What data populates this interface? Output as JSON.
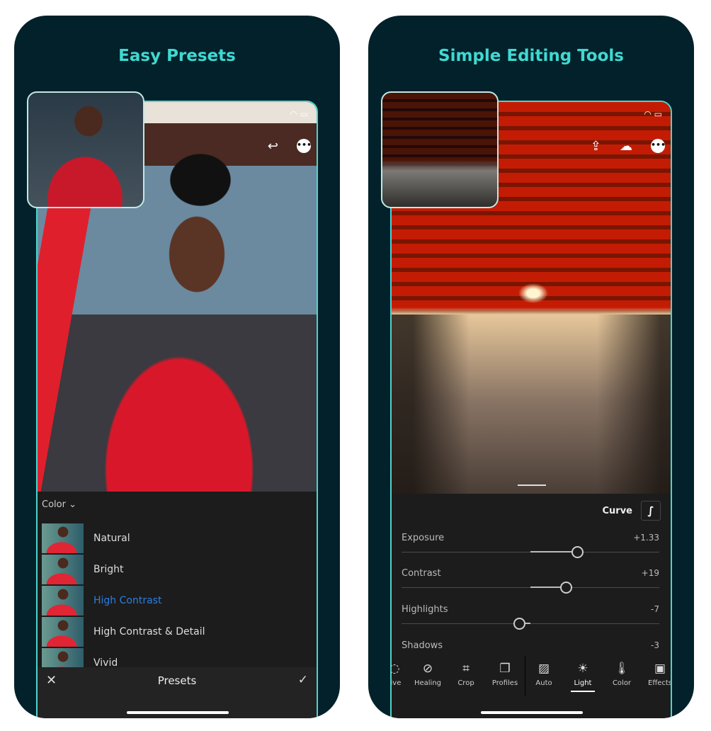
{
  "left_card": {
    "title": "Easy Presets",
    "status_icons": [
      "wifi-icon",
      "battery-icon"
    ],
    "top_icons": [
      "undo-icon",
      "more-icon"
    ],
    "category_label": "Color",
    "presets": [
      {
        "label": "Natural"
      },
      {
        "label": "Bright"
      },
      {
        "label": "High Contrast",
        "selected": true
      },
      {
        "label": "High Contrast & Detail"
      },
      {
        "label": "Vivid"
      }
    ],
    "bottom_bar": {
      "title": "Presets",
      "cancel_icon": "close-icon",
      "confirm_icon": "check-icon"
    },
    "selected_color": "#2a7ee0"
  },
  "right_card": {
    "title": "Simple Editing Tools",
    "top_icons": [
      "share-icon",
      "cloud-synced-icon",
      "more-icon"
    ],
    "curve_label": "Curve",
    "sliders": [
      {
        "name": "Exposure",
        "value": "+1.33",
        "level": 0.33
      },
      {
        "name": "Contrast",
        "value": "+19",
        "level": 0.25
      },
      {
        "name": "Highlights",
        "value": "-7",
        "level": -0.08
      },
      {
        "name": "Shadows",
        "value": "-3",
        "level": -0.03
      }
    ],
    "tools": [
      {
        "label": "tive",
        "icon": "selective-icon"
      },
      {
        "label": "Healing",
        "icon": "bandage-icon"
      },
      {
        "label": "Crop",
        "icon": "crop-icon"
      },
      {
        "label": "Profiles",
        "icon": "profiles-icon"
      },
      {
        "label": "Auto",
        "icon": "auto-icon"
      },
      {
        "label": "Light",
        "icon": "sun-icon",
        "active": true
      },
      {
        "label": "Color",
        "icon": "thermometer-icon"
      },
      {
        "label": "Effects",
        "icon": "effects-icon"
      }
    ]
  },
  "colors": {
    "card_bg": "#03212a",
    "title": "#3fd9d2",
    "frame": "#4fd3cc",
    "panel": "#1c1c1c"
  }
}
